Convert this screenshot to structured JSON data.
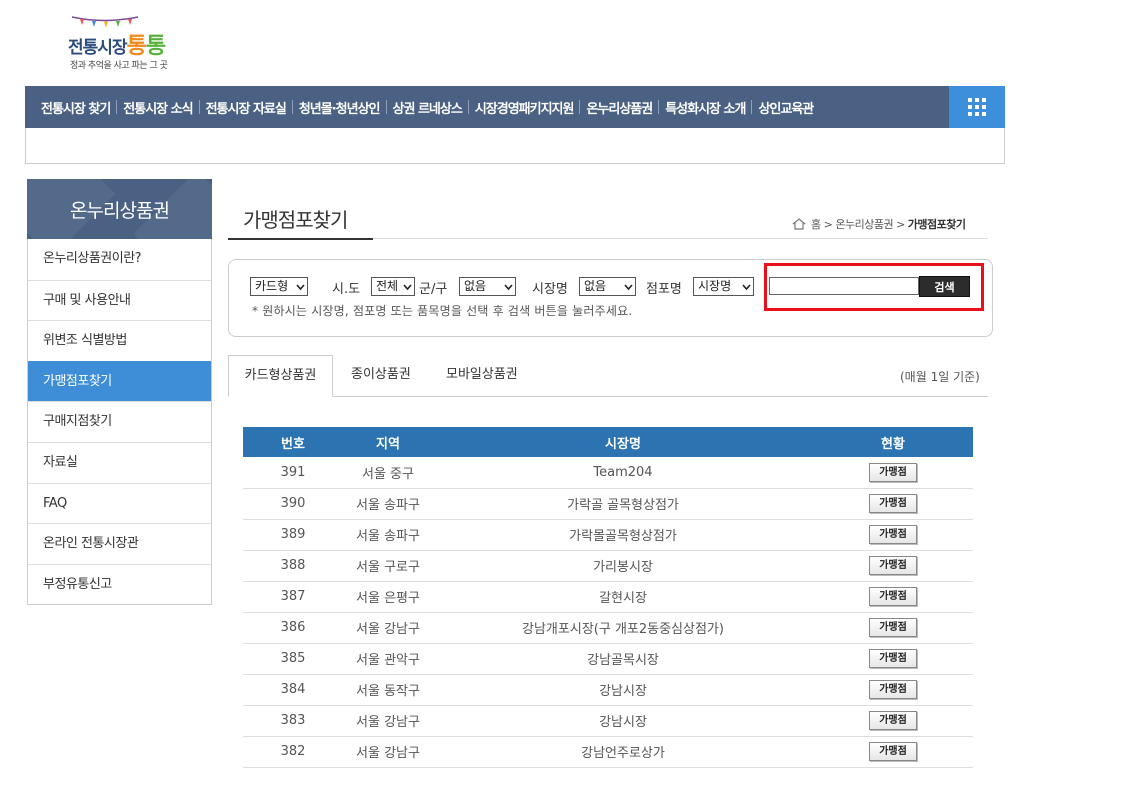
{
  "logo": {
    "main_part1": "전통시장",
    "main_part2": "통",
    "main_part3": "통",
    "tagline": "정과 추억을 사고 파는 그 곳"
  },
  "gnb": {
    "items": [
      "전통시장 찾기",
      "전통시장 소식",
      "전통시장 자료실",
      "청년몰·청년상인",
      "상권 르네상스",
      "시장경영패키지지원",
      "온누리상품권",
      "특성화시장 소개",
      "상인교육관"
    ],
    "menu_icon": "grid-icon"
  },
  "lnb": {
    "title": "온누리상품권",
    "items": [
      "온누리상품권이란?",
      "구매 및 사용안내",
      "위변조 식별방법",
      "가맹점포찾기",
      "구매지점찾기",
      "자료실",
      "FAQ",
      "온라인 전통시장관",
      "부정유통신고"
    ],
    "active_index": 3
  },
  "page": {
    "title": "가맹점포찾기",
    "breadcrumb": {
      "home": "홈",
      "section": "온누리상품권",
      "current": "가맹점포찾기"
    }
  },
  "search": {
    "voucher_type": "카드형",
    "sido_label": "시.도",
    "sido_value": "전체",
    "gungu_label": "군/구",
    "gungu_value": "없음",
    "market_label": "시장명",
    "market_value": "없음",
    "store_label": "점포명",
    "store_field_value": "시장명",
    "keyword_value": "",
    "button": "검색",
    "hint": "* 원하시는 시장명, 점포명 또는 품목명을 선택 후 검색 버튼을 눌러주세요."
  },
  "tabs": {
    "items": [
      "카드형상품권",
      "종이상품권",
      "모바일상품권"
    ],
    "active_index": 0,
    "basis_note": "(매월 1일 기준)"
  },
  "table": {
    "headers": [
      "번호",
      "지역",
      "시장명",
      "현황"
    ],
    "button_label": "가맹점",
    "rows": [
      {
        "no": "391",
        "region": "서울 중구",
        "market": "Team204"
      },
      {
        "no": "390",
        "region": "서울 송파구",
        "market": "가락골 골목형상점가"
      },
      {
        "no": "389",
        "region": "서울 송파구",
        "market": "가락몰골목형상점가"
      },
      {
        "no": "388",
        "region": "서울 구로구",
        "market": "가리봉시장"
      },
      {
        "no": "387",
        "region": "서울 은평구",
        "market": "갈현시장"
      },
      {
        "no": "386",
        "region": "서울 강남구",
        "market": "강남개포시장(구 개포2동중심상점가)"
      },
      {
        "no": "385",
        "region": "서울 관악구",
        "market": "강남골목시장"
      },
      {
        "no": "384",
        "region": "서울 동작구",
        "market": "강남시장"
      },
      {
        "no": "383",
        "region": "서울 강남구",
        "market": "강남시장"
      },
      {
        "no": "382",
        "region": "서울 강남구",
        "market": "강남언주로상가"
      }
    ]
  },
  "colors": {
    "nav_bg": "#4a6183",
    "accent_blue": "#3d8ed6",
    "table_header": "#2c73b2",
    "highlight": "#e8101a"
  }
}
